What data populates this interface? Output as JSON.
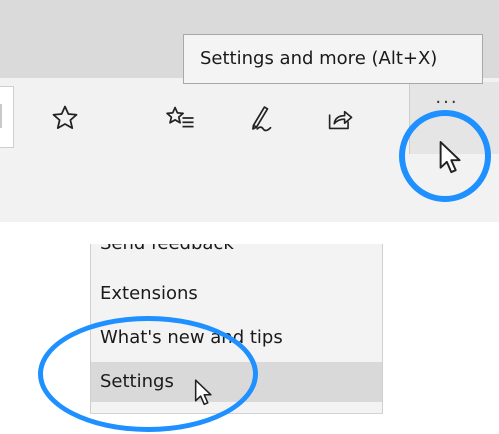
{
  "toolbar": {
    "tooltip": "Settings and more (Alt+X)",
    "more_label": "···",
    "icons": [
      "star-icon",
      "favorites-hub-icon",
      "pen-icon",
      "share-icon",
      "more-icon"
    ]
  },
  "menu": {
    "items": [
      {
        "label": "Send feedback"
      },
      {
        "label": "Extensions"
      },
      {
        "label": "What's new and tips"
      },
      {
        "label": "Settings"
      }
    ],
    "hovered_index": 3
  },
  "colors": {
    "highlight_ring": "#1e90ff",
    "hover_bg": "#d9d9d9",
    "panel_bg": "#f3f3f3"
  }
}
